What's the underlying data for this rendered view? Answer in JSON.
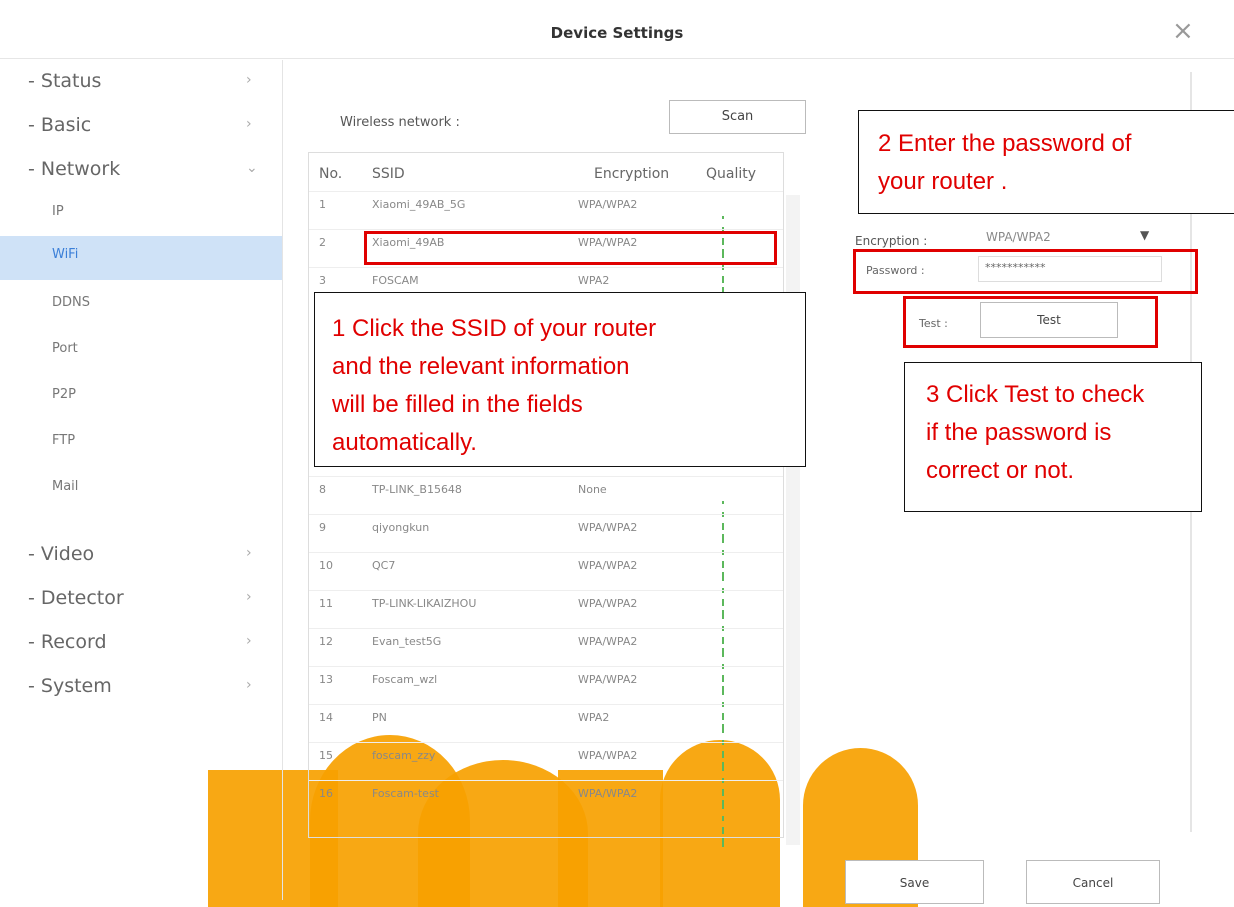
{
  "window": {
    "title": "Device Settings",
    "close_glyph": "×"
  },
  "sidebar": {
    "items": [
      {
        "label": "- Status",
        "chevron": "›"
      },
      {
        "label": "- Basic",
        "chevron": "›"
      },
      {
        "label": "- Network",
        "chevron": "⌄"
      },
      {
        "label": "IP"
      },
      {
        "label": "WiFi",
        "active": true
      },
      {
        "label": "DDNS"
      },
      {
        "label": "Port"
      },
      {
        "label": "P2P"
      },
      {
        "label": "FTP"
      },
      {
        "label": "Mail"
      },
      {
        "label": "- Video",
        "chevron": "›"
      },
      {
        "label": "- Detector",
        "chevron": "›"
      },
      {
        "label": "- Record",
        "chevron": "›"
      },
      {
        "label": "- System",
        "chevron": "›"
      }
    ]
  },
  "wireless": {
    "label": "Wireless network :",
    "scan_label": "Scan",
    "columns": [
      "No.",
      "SSID",
      "Encryption",
      "Quality"
    ],
    "rows": [
      {
        "no": "1",
        "ssid": "Xiaomi_49AB_5G",
        "enc": "WPA/WPA2"
      },
      {
        "no": "2",
        "ssid": "Xiaomi_49AB",
        "enc": "WPA/WPA2"
      },
      {
        "no": "3",
        "ssid": "FOSCAM",
        "enc": "WPA2"
      },
      {
        "no": "8",
        "ssid": "TP-LINK_B15648",
        "enc": "None"
      },
      {
        "no": "9",
        "ssid": "qiyongkun",
        "enc": "WPA/WPA2"
      },
      {
        "no": "10",
        "ssid": "QC7",
        "enc": "WPA/WPA2"
      },
      {
        "no": "11",
        "ssid": "TP-LINK-LIKAIZHOU",
        "enc": "WPA/WPA2"
      },
      {
        "no": "12",
        "ssid": "Evan_test5G",
        "enc": "WPA/WPA2"
      },
      {
        "no": "13",
        "ssid": "Foscam_wzl",
        "enc": "WPA/WPA2"
      },
      {
        "no": "14",
        "ssid": "PN",
        "enc": "WPA2"
      },
      {
        "no": "15",
        "ssid": "foscam_zzy",
        "enc": "WPA/WPA2"
      },
      {
        "no": "16",
        "ssid": "Foscam-test",
        "enc": "WPA/WPA2"
      }
    ]
  },
  "form": {
    "encryption_label": "Encryption :",
    "encryption_value": "WPA/WPA2",
    "password_label": "Password :",
    "password_value": "***********",
    "test_label": "Test :",
    "test_button": "Test"
  },
  "footer": {
    "save": "Save",
    "cancel": "Cancel"
  },
  "callouts": {
    "one": [
      "1 Click the SSID of your router",
      "and the relevant information",
      "will be filled in the fields",
      "automatically."
    ],
    "two": [
      "2 Enter the password of",
      "your router ."
    ],
    "three": [
      "3 Click Test to check",
      "if the password is",
      "correct or not."
    ]
  },
  "colors": {
    "accent": "#3b7fd8",
    "annotation": "#e00000",
    "watermark": "#f7a100",
    "signal": "#5cb85c"
  }
}
